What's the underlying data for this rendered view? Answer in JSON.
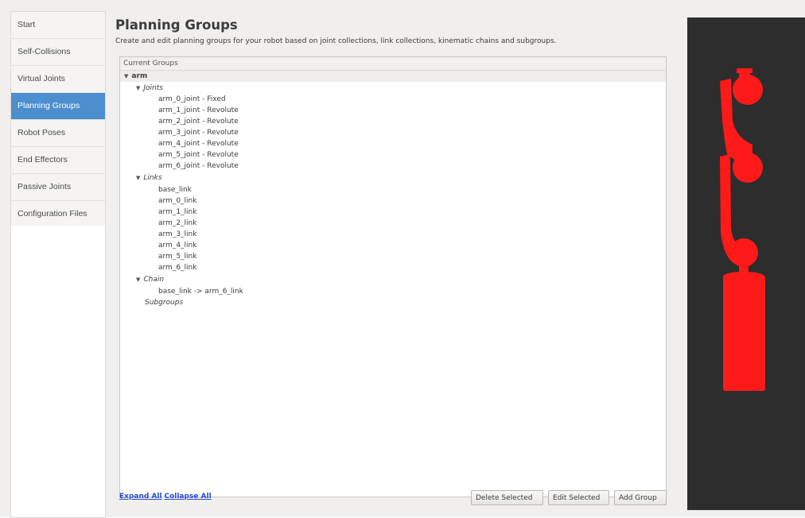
{
  "sidebar": {
    "items": [
      {
        "label": "Start"
      },
      {
        "label": "Self-Collisions"
      },
      {
        "label": "Virtual Joints"
      },
      {
        "label": "Planning Groups"
      },
      {
        "label": "Robot Poses"
      },
      {
        "label": "End Effectors"
      },
      {
        "label": "Passive Joints"
      },
      {
        "label": "Configuration Files"
      }
    ],
    "active_index": 3,
    "active_color": "#4c8fce"
  },
  "main": {
    "title": "Planning Groups",
    "description": "Create and edit planning groups for your robot based on joint collections, link collections, kinematic chains and subgroups.",
    "tree": {
      "header": "Current Groups",
      "group_name": "arm",
      "joints_label": "Joints",
      "joints": [
        "arm_0_joint - Fixed",
        "arm_1_joint - Revolute",
        "arm_2_joint - Revolute",
        "arm_3_joint - Revolute",
        "arm_4_joint - Revolute",
        "arm_5_joint - Revolute",
        "arm_6_joint - Revolute"
      ],
      "links_label": "Links",
      "links": [
        "base_link",
        "arm_0_link",
        "arm_1_link",
        "arm_2_link",
        "arm_3_link",
        "arm_4_link",
        "arm_5_link",
        "arm_6_link"
      ],
      "chain_label": "Chain",
      "chain": "base_link -> arm_6_link",
      "subgroups_label": "Subgroups"
    },
    "expand_all": "Expand All",
    "collapse_all": "Collapse All",
    "buttons": {
      "delete": "Delete Selected",
      "edit": "Edit Selected",
      "add": "Add Group"
    }
  },
  "viewport": {
    "background": "#2d2d2d",
    "robot_color": "#ff1a1a"
  }
}
